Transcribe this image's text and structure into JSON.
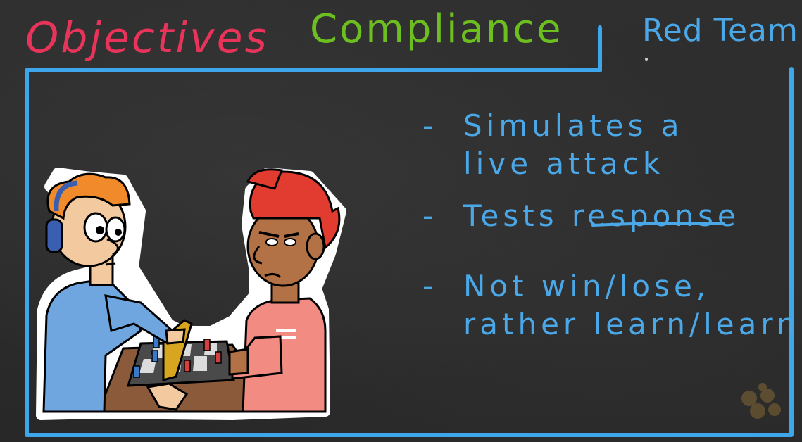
{
  "colors": {
    "objectives": "#e8335a",
    "compliance": "#6cbf1e",
    "red_team": "#4aa8e8",
    "frame": "#3ea6ea",
    "bullet_text": "#4aa8e8"
  },
  "tabs": {
    "objectives": "Objectives",
    "compliance": "Compliance",
    "red_team": "Red Team"
  },
  "bullets": [
    {
      "line1": "Simulates a",
      "line2": "live attack"
    },
    {
      "prefix": "Tests ",
      "emphasis": "response"
    },
    {
      "line1": "Not win/lose,",
      "line2": "rather learn/learn"
    }
  ],
  "illustration": "two-players-chess-cartoon-icon"
}
